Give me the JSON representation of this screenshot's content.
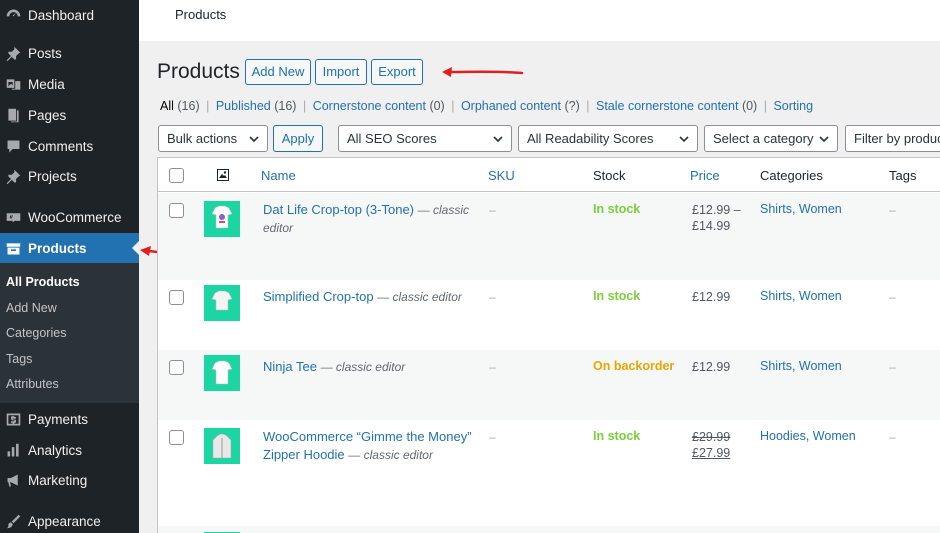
{
  "sidebar": {
    "items": [
      {
        "label": "Dashboard",
        "icon": "dashboard-icon"
      },
      {
        "label": "Posts",
        "icon": "pin-icon"
      },
      {
        "label": "Media",
        "icon": "media-icon"
      },
      {
        "label": "Pages",
        "icon": "pages-icon"
      },
      {
        "label": "Comments",
        "icon": "comment-icon"
      },
      {
        "label": "Projects",
        "icon": "pin-icon"
      },
      {
        "label": "WooCommerce",
        "icon": "woo-icon"
      },
      {
        "label": "Products",
        "icon": "archive-icon"
      },
      {
        "label": "Payments",
        "icon": "money-icon"
      },
      {
        "label": "Analytics",
        "icon": "chart-bar-icon"
      },
      {
        "label": "Marketing",
        "icon": "megaphone-icon"
      },
      {
        "label": "Appearance",
        "icon": "brush-icon"
      }
    ],
    "submenu": [
      {
        "label": "All Products"
      },
      {
        "label": "Add New"
      },
      {
        "label": "Categories"
      },
      {
        "label": "Tags"
      },
      {
        "label": "Attributes"
      }
    ]
  },
  "topbar": {
    "title": "Products"
  },
  "header": {
    "title": "Products",
    "buttons": {
      "add_new": "Add New",
      "import": "Import",
      "export": "Export"
    }
  },
  "views": {
    "all": {
      "label": "All",
      "count": "(16)"
    },
    "published": {
      "label": "Published",
      "count": "(16)"
    },
    "cornerstone": {
      "label": "Cornerstone content",
      "count": "(0)"
    },
    "orphaned": {
      "label": "Orphaned content",
      "count": "(?)"
    },
    "stale": {
      "label": "Stale cornerstone content",
      "count": "(0)"
    },
    "sorting": {
      "label": "Sorting"
    },
    "separator": "|"
  },
  "filters": {
    "bulk_actions": "Bulk actions",
    "apply": "Apply",
    "seo": "All SEO Scores",
    "readability": "All Readability Scores",
    "category": "Select a category",
    "product_type": "Filter by product type"
  },
  "table": {
    "columns": {
      "name": "Name",
      "sku": "SKU",
      "stock": "Stock",
      "price": "Price",
      "categories": "Categories",
      "tags": "Tags"
    },
    "rows": [
      {
        "name": "Dat Life Crop-top (3-Tone)",
        "state": "— classic editor",
        "sku": "–",
        "stock": "In stock",
        "price_line1": "£12.99 –",
        "price_line2": "£14.99",
        "categories": "Shirts, Women",
        "tags": "–"
      },
      {
        "name": "Simplified Crop-top",
        "state": "— classic editor",
        "sku": "–",
        "stock": "In stock",
        "price_line1": "£12.99",
        "categories": "Shirts, Women",
        "tags": "–"
      },
      {
        "name": "Ninja Tee",
        "state": "— classic editor",
        "sku": "–",
        "stock": "On backorder",
        "price_line1": "£12.99",
        "categories": "Shirts, Women",
        "tags": "–"
      },
      {
        "name": "WooCommerce “Gimme the Money” Zipper Hoodie",
        "state": "— classic editor",
        "sku": "–",
        "stock": "In stock",
        "price_regular": "£29.99",
        "price_sale": "£27.99",
        "categories": "Hoodies, Women",
        "tags": "–"
      }
    ]
  },
  "colors": {
    "admin_menu": "#1d2327",
    "accent": "#2271b1",
    "in_stock": "#7ad03a",
    "backorder": "#eaa600",
    "annotation_arrow": "#e0201f",
    "thumbnail_bg": "#1bd5a2"
  }
}
